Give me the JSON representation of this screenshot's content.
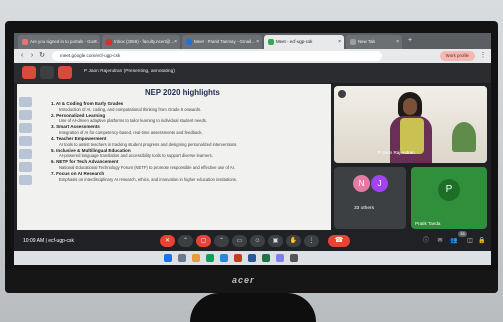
{
  "browser": {
    "tabs": [
      {
        "label": "Are you signed in to portals - Goo...",
        "color": "#e57373"
      },
      {
        "label": "Inbox (3059) - faculty.ncert@...",
        "color": "#d93025"
      },
      {
        "label": "Meet - Pranit Tanmay - Gmail...",
        "color": "#1a73e8"
      },
      {
        "label": "Meet - ecf-ugp-csk",
        "color": "#34a853"
      },
      {
        "label": "New Tab",
        "color": "#9e9e9e"
      }
    ],
    "url": "meet.google.com/ecf-ugp-csk",
    "profile_label": "Work profile"
  },
  "meet": {
    "presenting_text": "P Jaon Rajendran (Presenting, annotating)",
    "slide": {
      "title": "NEP 2020 highlights",
      "items": [
        {
          "heading": "1. AI & Coding from Early Grades",
          "body": "Introduction of AI, coding, and computational thinking from Grade 6 onwards."
        },
        {
          "heading": "2. Personalized Learning",
          "body": "Use of AI-driven adaptive platforms to tailor learning to individual student needs."
        },
        {
          "heading": "3. Smart Assessments",
          "body": "Integration of AI for competency-based, real-time assessments and feedback."
        },
        {
          "heading": "4. Teacher Empowerment",
          "body": "AI tools to assist teachers in tracking student progress and designing personalized interventions."
        },
        {
          "heading": "5. Inclusive & Multilingual Education",
          "body": "AI-powered language translation and accessibility tools to support diverse learners."
        },
        {
          "heading": "6. NETF for Tech Advancement",
          "body": "National Educational Technology Forum (NETF) to promote responsible and effective use of AI."
        },
        {
          "heading": "7. Focus on AI Research",
          "body": "Emphasis on interdisciplinary AI research, ethics, and innovation in higher education institutions."
        }
      ]
    },
    "self_name": "P Jaon Rajendran",
    "others": {
      "initials": [
        "N",
        "J"
      ],
      "colors": [
        "#e57ba3",
        "#a142f4"
      ],
      "label": "33 others"
    },
    "pinned": {
      "initial": "P",
      "name": "Pratik Tanda"
    },
    "time": "10:09 AM",
    "meeting_code": "ecf-ugp-csk",
    "participant_count": "35"
  },
  "monitor": {
    "brand": "acer"
  }
}
